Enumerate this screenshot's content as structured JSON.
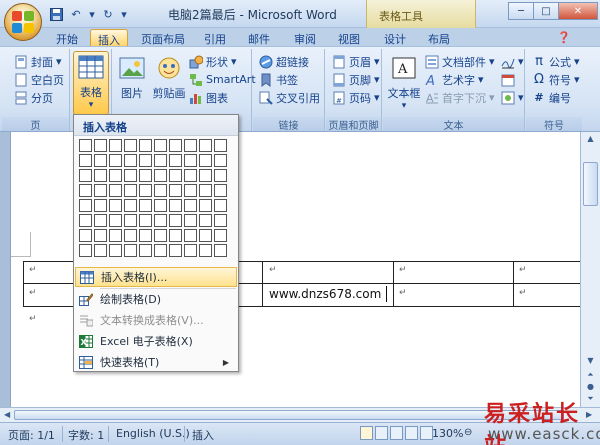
{
  "window": {
    "title": "电脑2篇最后 - Microsoft Word",
    "context_tab_group": "表格工具",
    "controls": [
      "─",
      "□",
      "✕"
    ]
  },
  "quick_access": [
    "save-icon",
    "undo-icon",
    "redo-icon",
    "customize-icon"
  ],
  "tabs": [
    {
      "label": "开始"
    },
    {
      "label": "插入"
    },
    {
      "label": "页面布局"
    },
    {
      "label": "引用"
    },
    {
      "label": "邮件"
    },
    {
      "label": "审阅"
    },
    {
      "label": "视图"
    },
    {
      "label": "设计"
    },
    {
      "label": "布局"
    }
  ],
  "active_tab": "插入",
  "ribbon": {
    "pages": {
      "label": "页",
      "items": [
        "封面",
        "空白页",
        "分页"
      ]
    },
    "tables": {
      "label": "表格"
    },
    "illustrations": {
      "items": [
        "图片",
        "剪贴画",
        "形状",
        "SmartArt",
        "图表"
      ]
    },
    "links": {
      "label": "链接",
      "items": [
        "超链接",
        "书签",
        "交叉引用"
      ]
    },
    "header_footer": {
      "label": "页眉和页脚",
      "items": [
        "页眉",
        "页脚",
        "页码"
      ]
    },
    "text": {
      "label": "文本",
      "textbox": "文本框",
      "items": [
        "文档部件",
        "艺术字",
        "首字下沉"
      ]
    },
    "symbols": {
      "label": "符号",
      "items": [
        "公式",
        "符号",
        "编号"
      ]
    }
  },
  "dropdown": {
    "header": "插入表格",
    "grid": {
      "cols": 10,
      "rows": 8
    },
    "items": [
      {
        "label": "插入表格(I)...",
        "icon": "insert-table-icon",
        "state": "highlighted"
      },
      {
        "label": "绘制表格(D)",
        "icon": "draw-table-icon",
        "state": "normal"
      },
      {
        "label": "文本转换成表格(V)...",
        "icon": "text-to-table-icon",
        "state": "disabled"
      },
      {
        "label": "Excel 电子表格(X)",
        "icon": "excel-icon",
        "state": "normal"
      },
      {
        "label": "快速表格(T)",
        "icon": "quick-table-icon",
        "state": "normal",
        "submenu": true
      }
    ]
  },
  "document": {
    "cell_text": "www.dnzs678.com",
    "paragraph_mark": "↵"
  },
  "status": {
    "page": "页面: 1/1",
    "words": "字数: 1",
    "language": "English (U.S.)",
    "mode": "插入",
    "zoom": "130%"
  },
  "watermark": {
    "top": "易采站长站",
    "bottom": "www.easck.com"
  },
  "colors": {
    "accent": "#15428b",
    "highlight": "#ffe28e",
    "excel": "#1d7a3a"
  }
}
